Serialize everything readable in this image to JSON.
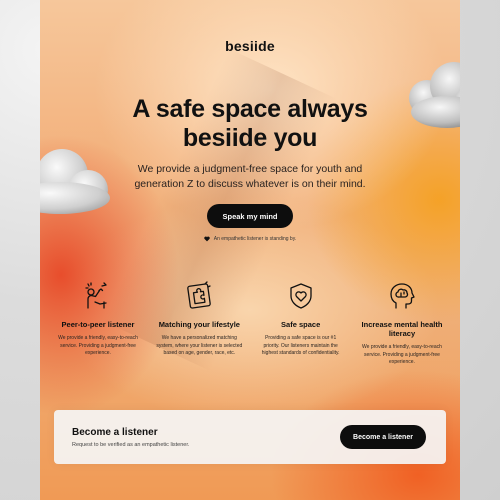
{
  "header": {
    "logo": "besiide"
  },
  "hero": {
    "title_line1": "A safe space always",
    "title_line2": "besiide you",
    "subtitle": "We provide a judgment-free space for youth and generation Z to discuss whatever is on their mind.",
    "cta_label": "Speak my mind",
    "status_text": "An empathetic listener is standing by."
  },
  "features": [
    {
      "icon": "peer-listener-icon",
      "title": "Peer-to-peer listener",
      "desc": "We provide a friendly, easy-to-reach service. Providing a judgment-free experience."
    },
    {
      "icon": "puzzle-matching-icon",
      "title": "Matching your lifestyle",
      "desc": "We have a personalized matching system, where your listener is selected based on age, gender, race, etc."
    },
    {
      "icon": "shield-heart-icon",
      "title": "Safe space",
      "desc": "Providing a safe space is our #1 priority. Our listeners maintain the highest standards of confidentiality."
    },
    {
      "icon": "head-brain-icon",
      "title": "Increase mental health literacy",
      "desc": "We provide a friendly, easy-to-reach service. Providing a judgment-free experience."
    }
  ],
  "listener": {
    "title": "Become a listener",
    "desc": "Request to be verified as an empathetic listener.",
    "button_label": "Become a listener"
  },
  "colors": {
    "accent": "#0d0d0d",
    "warm_orange": "#f09a55",
    "red": "#e63c1e"
  }
}
